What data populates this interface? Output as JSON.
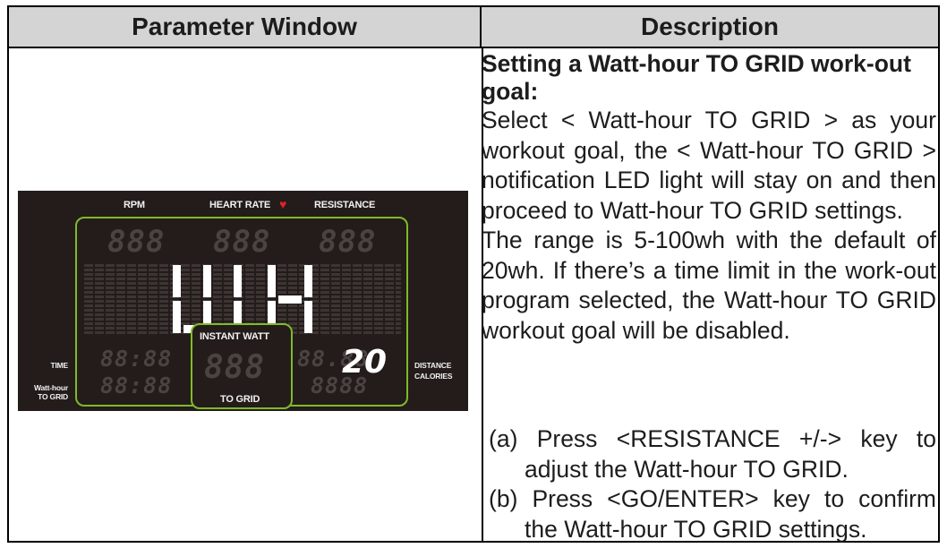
{
  "table": {
    "header_left": "Parameter Window",
    "header_right": "Description"
  },
  "display": {
    "labels": {
      "rpm": "RPM",
      "heart_rate": "HEART RATE",
      "resistance": "RESISTANCE",
      "time": "TIME",
      "watt_hour_to_grid": "Watt-hour\nTO GRID",
      "instant_watt": "INSTANT WATT",
      "to_grid": "TO GRID",
      "distance": "DISTANCE",
      "calories": "CALORIES"
    },
    "ghost_digits": {
      "rpm": "888",
      "heart_rate": "888",
      "resistance": "888",
      "time": "88:88",
      "watt_hour": "88:88",
      "instant_watt": "888",
      "distance": "88.88",
      "calories": "8888"
    },
    "goal_value": "20",
    "main_mode": "WH",
    "colors": {
      "frame": "#7fba2a",
      "panel": "#231c1a",
      "heart": "#e0202e"
    }
  },
  "description": {
    "title": "Setting a Watt-hour TO GRID work-out goal:",
    "body1": "Select < Watt-hour TO GRID > as your workout goal, the < Watt-hour TO GRID > notification LED light will stay on and then proceed to Watt-hour TO GRID settings.",
    "body2": "The range is 5-100wh with the default of 20wh. If there’s a time limit in the work-out program selected, the Watt-hour TO GRID workout goal will be disabled.",
    "step_a": "(a) Press <RESISTANCE +/-> key to adjust the Watt-hour TO GRID.",
    "step_b": "(b) Press <GO/ENTER> key to confirm the Watt-hour TO GRID settings."
  }
}
